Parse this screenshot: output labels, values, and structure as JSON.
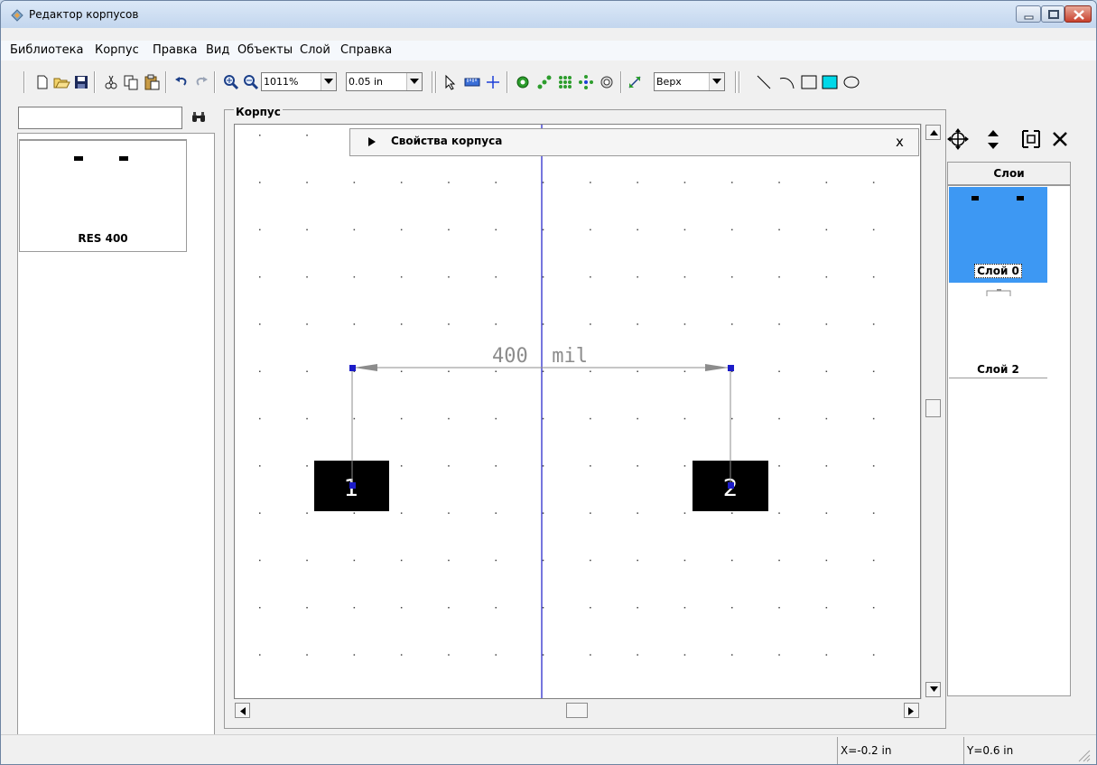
{
  "window": {
    "title": "Редактор корпусов"
  },
  "menu": [
    "Библиотека",
    "Корпус",
    "Правка",
    "Вид",
    "Объекты",
    "Слой",
    "Справка"
  ],
  "toolbar": {
    "zoom_value": "1011%",
    "grid_value": "0.05 in",
    "side_value": "Верх"
  },
  "library": {
    "search_placeholder": "",
    "items": [
      {
        "label": "RES 400"
      }
    ]
  },
  "editor": {
    "frame_title": "Корпус",
    "properties_panel_title": "Свойства корпуса",
    "properties_close": "x",
    "dimension_label": "400  mil",
    "pads": [
      "1",
      "2"
    ]
  },
  "layers": {
    "header": "Слои",
    "items": [
      {
        "label": "Слой 0",
        "selected": true
      },
      {
        "label": "Слой 2",
        "selected": false
      }
    ]
  },
  "status": {
    "x": "X=-0.2 in",
    "y": "Y=0.6 in"
  },
  "colors": {
    "selected_layer": "#3d98f3",
    "canvas_axis": "#1c1cc8",
    "pad": "#000000",
    "dimension": "#8c8c8c"
  }
}
